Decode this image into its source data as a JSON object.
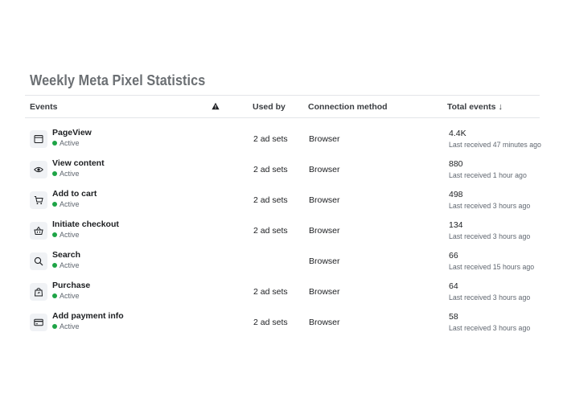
{
  "title": "Weekly Meta Pixel Statistics",
  "header": {
    "events": "Events",
    "used_by": "Used by",
    "connection_method": "Connection method",
    "total_events": "Total events",
    "sort_arrow": "↓"
  },
  "rows": [
    {
      "icon": "browser-window-icon",
      "name": "PageView",
      "status": "Active",
      "used_by": "2 ad sets",
      "connection": "Browser",
      "total": "4.4K",
      "last_received": "Last received 47 minutes ago"
    },
    {
      "icon": "eye-icon",
      "name": "View content",
      "status": "Active",
      "used_by": "2 ad sets",
      "connection": "Browser",
      "total": "880",
      "last_received": "Last received 1 hour ago"
    },
    {
      "icon": "cart-icon",
      "name": "Add to cart",
      "status": "Active",
      "used_by": "2 ad sets",
      "connection": "Browser",
      "total": "498",
      "last_received": "Last received 3 hours ago"
    },
    {
      "icon": "basket-icon",
      "name": "Initiate checkout",
      "status": "Active",
      "used_by": "2 ad sets",
      "connection": "Browser",
      "total": "134",
      "last_received": "Last received 3 hours ago"
    },
    {
      "icon": "search-icon",
      "name": "Search",
      "status": "Active",
      "used_by": "",
      "connection": "Browser",
      "total": "66",
      "last_received": "Last received 15 hours ago"
    },
    {
      "icon": "shopping-bag-icon",
      "name": "Purchase",
      "status": "Active",
      "used_by": "2 ad sets",
      "connection": "Browser",
      "total": "64",
      "last_received": "Last received 3 hours ago"
    },
    {
      "icon": "credit-card-icon",
      "name": "Add payment info",
      "status": "Active",
      "used_by": "2 ad sets",
      "connection": "Browser",
      "total": "58",
      "last_received": "Last received 3 hours ago"
    }
  ],
  "colors": {
    "active": "#1ea446",
    "title": "#6b6f73"
  }
}
